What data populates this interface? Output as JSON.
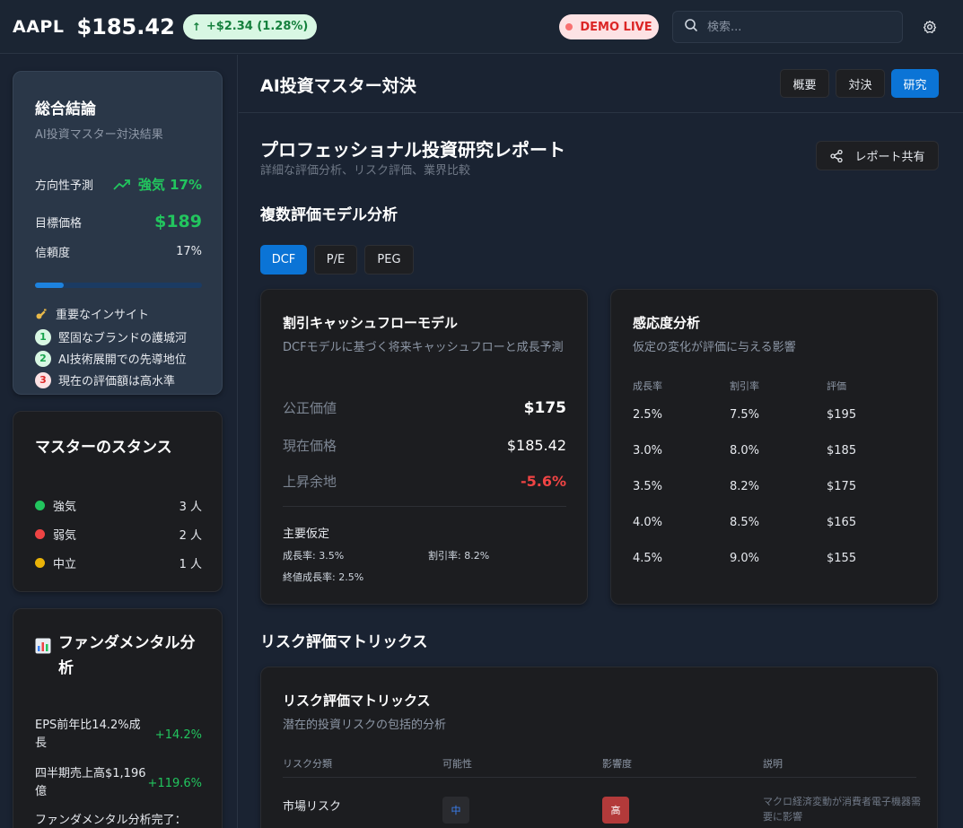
{
  "topbar": {
    "ticker": "AAPL",
    "price": "$185.42",
    "change": "+$2.34 (1.28%)",
    "demo_label": "DEMO LIVE",
    "search_placeholder": "検索..."
  },
  "summary": {
    "title": "総合結論",
    "subtitle": "AI投資マスター対決結果",
    "direction_label": "方向性予測",
    "direction_value": "強気 17%",
    "target_label": "目標価格",
    "target_value": "$189",
    "confidence_label": "信頼度",
    "confidence_value": "17%",
    "confidence_fraction": 0.17,
    "insights_title": "重要なインサイト",
    "insights": [
      {
        "num": "1",
        "text": "堅固なブランドの護城河"
      },
      {
        "num": "2",
        "text": "AI技術展開での先導地位"
      },
      {
        "num": "3",
        "text": "現在の評価額は高水準"
      }
    ]
  },
  "stance": {
    "title": "マスターのスタンス",
    "items": [
      {
        "label": "強気",
        "count": "3 人",
        "color": "#22c55e"
      },
      {
        "label": "弱気",
        "count": "2 人",
        "color": "#ef4444"
      },
      {
        "label": "中立",
        "count": "1 人",
        "color": "#eab308"
      }
    ]
  },
  "fundamental": {
    "title": "ファンダメンタル分析",
    "rows": [
      {
        "text": "EPS前年比14.2%成長",
        "value": "+14.2%"
      },
      {
        "text": "四半期売上高$1,196億",
        "value": "+119.6%"
      },
      {
        "text": "ファンダメンタル分析完了：",
        "value": ""
      }
    ]
  },
  "main": {
    "title": "AI投資マスター対決",
    "tabs": [
      "概要",
      "対決",
      "研究"
    ],
    "active_tab": "研究",
    "report_title": "プロフェッショナル投資研究レポート",
    "report_subtitle": "詳細な評価分析、リスク評価、業界比較",
    "share_label": "レポート共有",
    "valuation_heading": "複数評価モデル分析",
    "models": [
      "DCF",
      "P/E",
      "PEG"
    ],
    "active_model": "DCF"
  },
  "dcf": {
    "title": "割引キャッシュフローモデル",
    "subtitle": "DCFモデルに基づく将来キャッシュフローと成長予測",
    "fair_label": "公正価値",
    "fair_value": "$175",
    "current_label": "現在価格",
    "current_value": "$185.42",
    "upside_label": "上昇余地",
    "upside_value": "-5.6%",
    "assumptions_title": "主要仮定",
    "growth": "成長率: 3.5%",
    "discount": "割引率: 8.2%",
    "terminal": "終値成長率: 2.5%"
  },
  "sensitivity": {
    "title": "感応度分析",
    "subtitle": "仮定の変化が評価に与える影響",
    "headers": [
      "成長率",
      "割引率",
      "評価"
    ],
    "rows": [
      [
        "2.5%",
        "7.5%",
        "$195"
      ],
      [
        "3.0%",
        "8.0%",
        "$185"
      ],
      [
        "3.5%",
        "8.2%",
        "$175"
      ],
      [
        "4.0%",
        "8.5%",
        "$165"
      ],
      [
        "4.5%",
        "9.0%",
        "$155"
      ]
    ]
  },
  "risk": {
    "heading": "リスク評価マトリックス",
    "title": "リスク評価マトリックス",
    "subtitle": "潜在的投資リスクの包括的分析",
    "headers": [
      "リスク分類",
      "可能性",
      "影響度",
      "説明"
    ],
    "rows": [
      {
        "category": "市場リスク",
        "likelihood": "中",
        "impact": "高",
        "description": "マクロ経済変動が消費者電子機器需要に影響"
      }
    ]
  }
}
